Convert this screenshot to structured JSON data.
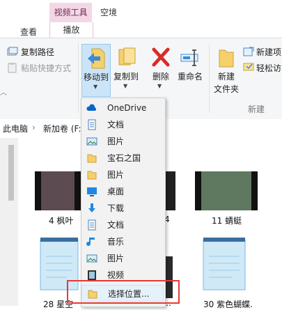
{
  "ribbon": {
    "context_tab": "视频工具",
    "context_subtab": "播放",
    "tab_view": "查看",
    "tab_empty": "空境",
    "copy_path": "复制路径",
    "paste_shortcut": "粘贴快捷方式",
    "move_to": "移动到",
    "copy_to": "复制到",
    "delete": "删除",
    "rename": "重命名",
    "new_folder_line1": "新建",
    "new_folder_line2": "文件夹",
    "new_item": "新建项",
    "easy_access": "轻松访",
    "group_new": "新建"
  },
  "address": {
    "this_pc": "此电脑",
    "drive": "新加卷 (F:)"
  },
  "files": [
    {
      "label": "4 枫叶"
    },
    {
      "label": "4"
    },
    {
      "label": "11 蜻蜓"
    },
    {
      "label": "28 星空"
    },
    {
      "label": "…"
    },
    {
      "label": "30 紫色蝴蝶."
    }
  ],
  "menu": {
    "items": [
      {
        "label": "OneDrive",
        "icon": "cloud-icon"
      },
      {
        "label": "文档",
        "icon": "document-icon"
      },
      {
        "label": "图片",
        "icon": "picture-icon"
      },
      {
        "label": "宝石之国",
        "icon": "folder-icon"
      },
      {
        "label": "图片",
        "icon": "folder-icon"
      },
      {
        "label": "桌面",
        "icon": "desktop-icon"
      },
      {
        "label": "下载",
        "icon": "download-icon"
      },
      {
        "label": "文档",
        "icon": "document-icon"
      },
      {
        "label": "音乐",
        "icon": "music-icon"
      },
      {
        "label": "图片",
        "icon": "picture-icon"
      },
      {
        "label": "视频",
        "icon": "video-icon"
      },
      {
        "label": "选择位置...",
        "icon": "folder-icon"
      }
    ]
  },
  "colors": {
    "accent_context": "#f4d7e6",
    "selection": "#cce4f7",
    "highlight_box": "#e53935",
    "delete_red": "#d92b2b",
    "folder_yellow": "#f5d06b"
  }
}
